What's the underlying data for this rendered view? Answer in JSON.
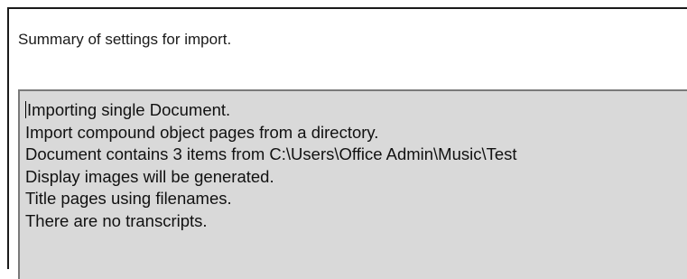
{
  "dialog": {
    "heading": "Summary of settings for import."
  },
  "summary": {
    "lines": [
      "Importing single Document.",
      "Import compound object pages from a directory.",
      "Document contains 3 items from C:\\Users\\Office Admin\\Music\\Test",
      "Display images will be generated.",
      "Title pages using filenames.",
      "There are no transcripts."
    ]
  },
  "colors": {
    "summary_background": "#d9d9d9",
    "window_border": "#1a1a1a",
    "summary_border": "#7a7a7a"
  }
}
